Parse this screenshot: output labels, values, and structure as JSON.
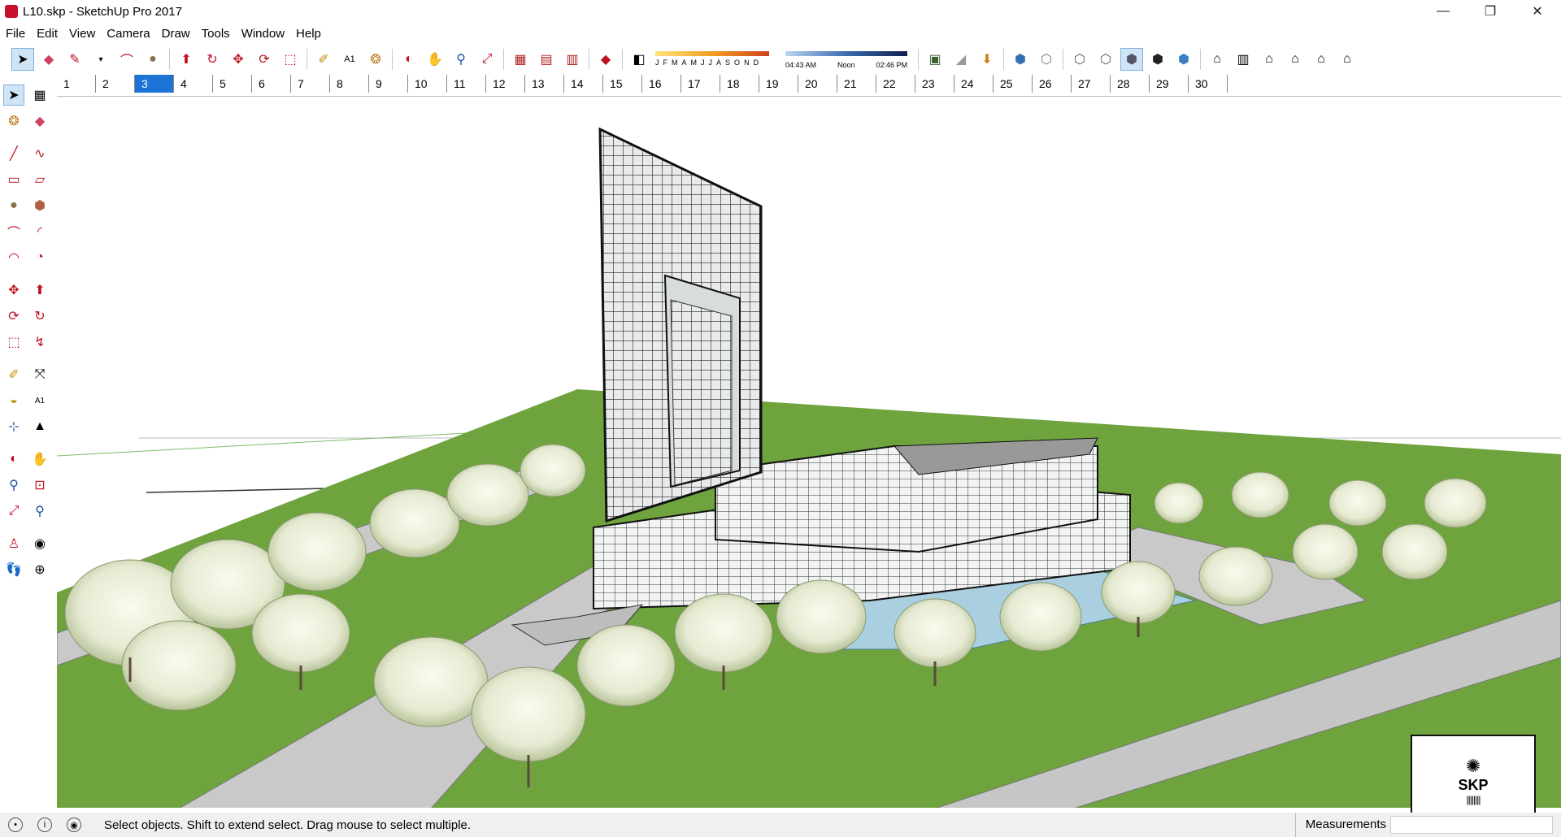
{
  "window": {
    "title": "L10.skp - SketchUp Pro 2017",
    "controls": [
      "—",
      "❐",
      "✕"
    ]
  },
  "menu": [
    "File",
    "Edit",
    "View",
    "Camera",
    "Draw",
    "Tools",
    "Window",
    "Help"
  ],
  "toolbar": {
    "icons": [
      "select-icon",
      "eraser-icon",
      "pencil-icon",
      "line-dropdown-icon",
      "arc-icon",
      "circle-icon",
      "pushpull-icon",
      "followme-icon",
      "move-icon",
      "rotate-icon",
      "scale-icon",
      "tape-icon",
      "text-icon",
      "paint-icon",
      "orbit-icon",
      "pan-icon",
      "zoom-icon",
      "zoom-extents-icon",
      "warehouse-icon",
      "extension-icon",
      "layout-icon",
      "ruby-icon"
    ],
    "shadow_months": [
      "J",
      "F",
      "M",
      "A",
      "M",
      "J",
      "J",
      "A",
      "S",
      "O",
      "N",
      "D"
    ],
    "shadow_times": [
      "04:43 AM",
      "Noon",
      "02:46 PM"
    ]
  },
  "scenes": [
    "1",
    "2",
    "3",
    "4",
    "5",
    "6",
    "7",
    "8",
    "9",
    "10",
    "11",
    "12",
    "13",
    "14",
    "15",
    "16",
    "17",
    "18",
    "19",
    "20",
    "21",
    "22",
    "23",
    "24",
    "25",
    "26",
    "27",
    "28",
    "29",
    "30"
  ],
  "active_scene": "3",
  "status": {
    "message": "Select objects. Shift to extend select. Drag mouse to select multiple.",
    "measurements_label": "Measurements",
    "measurements_value": ""
  },
  "thumbnail": {
    "label": "SKP"
  }
}
